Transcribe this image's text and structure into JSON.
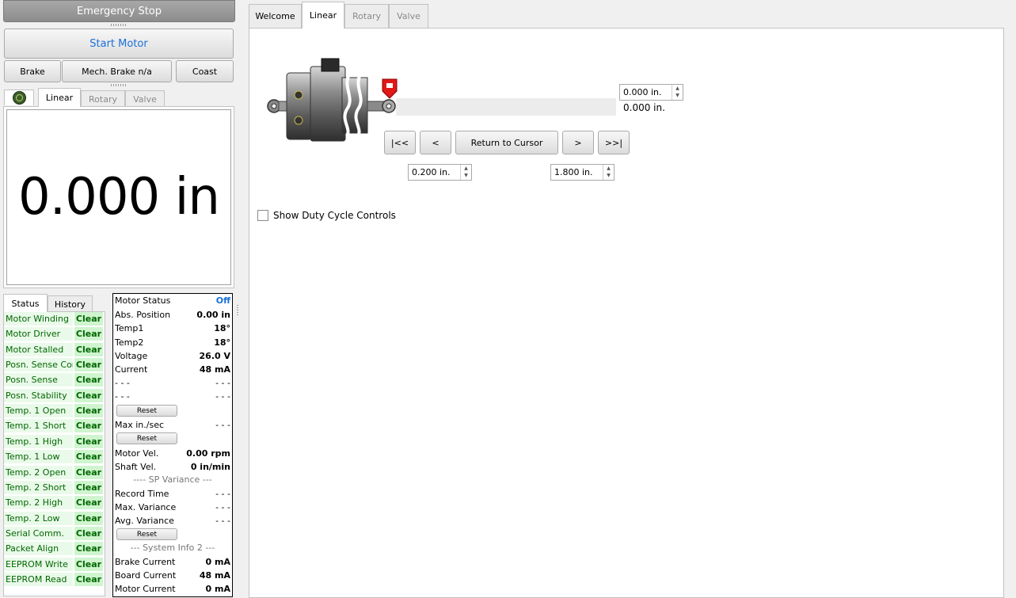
{
  "controls": {
    "emergency_stop": "Emergency Stop",
    "start_motor": "Start Motor",
    "brake": "Brake",
    "mech_brake": "Mech. Brake n/a",
    "coast": "Coast"
  },
  "left_tabs": {
    "icon": "globe-icon",
    "items": [
      "Linear",
      "Rotary",
      "Valve"
    ],
    "active": "Linear"
  },
  "position_display": "0.000 in",
  "status_tabs": [
    "Status",
    "History"
  ],
  "status_items": [
    {
      "label": "Motor Winding",
      "value": "Clear"
    },
    {
      "label": "Motor Driver",
      "value": "Clear"
    },
    {
      "label": "Motor Stalled",
      "value": "Clear"
    },
    {
      "label": "Posn. Sense Com",
      "value": "Clear"
    },
    {
      "label": "Posn. Sense",
      "value": "Clear"
    },
    {
      "label": "Posn. Stability",
      "value": "Clear"
    },
    {
      "label": "Temp. 1 Open",
      "value": "Clear"
    },
    {
      "label": "Temp. 1 Short",
      "value": "Clear"
    },
    {
      "label": "Temp. 1 High",
      "value": "Clear"
    },
    {
      "label": "Temp. 1 Low",
      "value": "Clear"
    },
    {
      "label": "Temp. 2 Open",
      "value": "Clear"
    },
    {
      "label": "Temp. 2 Short",
      "value": "Clear"
    },
    {
      "label": "Temp. 2 High",
      "value": "Clear"
    },
    {
      "label": "Temp. 2 Low",
      "value": "Clear"
    },
    {
      "label": "Serial Comm.",
      "value": "Clear"
    },
    {
      "label": "Packet Align",
      "value": "Clear"
    },
    {
      "label": "EEPROM Write",
      "value": "Clear"
    },
    {
      "label": "EEPROM Read",
      "value": "Clear"
    }
  ],
  "motor": {
    "motor_status": {
      "label": "Motor Status",
      "value": "Off",
      "value_color": "#1a6fd8"
    },
    "abs_position": {
      "label": "Abs. Position",
      "value": "0.00 in"
    },
    "temp1": {
      "label": "Temp1",
      "value": "18°"
    },
    "temp2": {
      "label": "Temp2",
      "value": "18°"
    },
    "voltage": {
      "label": "Voltage",
      "value": "26.0 V"
    },
    "current": {
      "label": "Current",
      "value": "48 mA"
    },
    "blank1": {
      "label": "- - -",
      "value": "- - -"
    },
    "blank2": {
      "label": "- - -",
      "value": "- - -"
    },
    "reset_label": "Reset",
    "max_ips": {
      "label": "Max in./sec",
      "value": "- - -"
    },
    "motor_vel": {
      "label": "Motor Vel.",
      "value": "0.00 rpm"
    },
    "shaft_vel": {
      "label": "Shaft Vel.",
      "value": "0 in/min"
    },
    "sp_variance_header": "---- SP Variance ---",
    "record_time": {
      "label": "Record Time",
      "value": "- - -"
    },
    "max_variance": {
      "label": "Max. Variance",
      "value": "- - -"
    },
    "avg_variance": {
      "label": "Avg. Variance",
      "value": "- - -"
    },
    "system_info_header": "--- System Info 2 ---",
    "brake_current": {
      "label": "Brake Current",
      "value": "0 mA"
    },
    "board_current": {
      "label": "Board Current",
      "value": "48 mA"
    },
    "motor_current": {
      "label": "Motor Current",
      "value": "0 mA"
    }
  },
  "main_tabs": {
    "items": [
      "Welcome",
      "Linear",
      "Rotary",
      "Valve"
    ],
    "active": "Linear"
  },
  "linear": {
    "target_value": "0.000 in.",
    "actual_value": "0.000 in.",
    "nav": {
      "first": "|<<",
      "prev": "<",
      "return": "Return to Cursor",
      "next": ">",
      "last": ">>|"
    },
    "min_value": "0.200 in.",
    "max_value": "1.800 in.",
    "duty_cycle_label": "Show Duty Cycle Controls",
    "duty_cycle_checked": false
  },
  "colors": {
    "cursor_marker": "#e01818",
    "status_text": "#006600",
    "start_motor_text": "#1a6fd8"
  }
}
